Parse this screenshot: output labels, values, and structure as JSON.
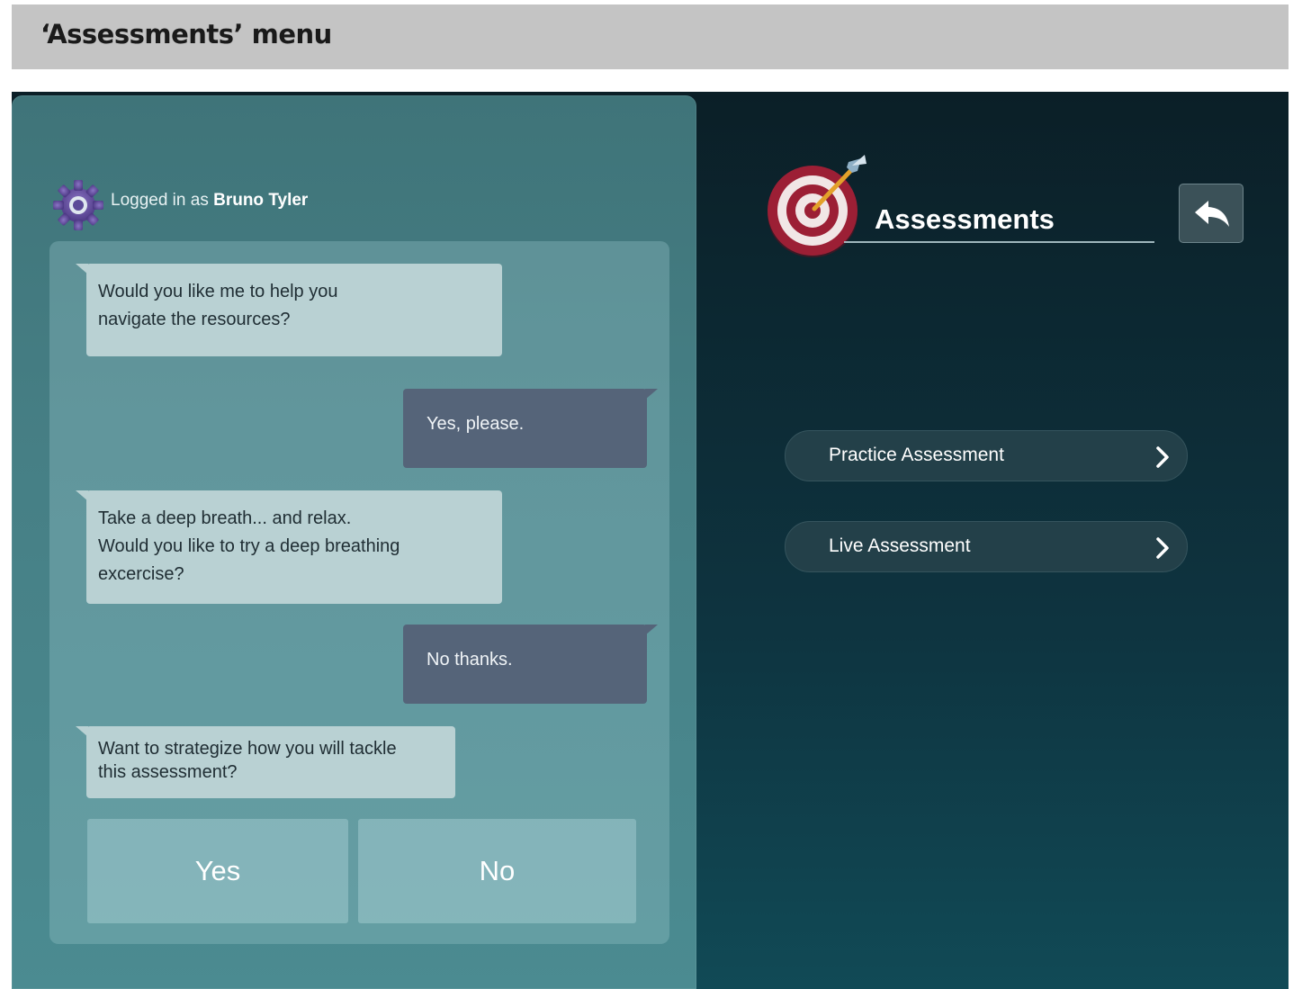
{
  "page_title": "‘Assessments’ menu",
  "chat": {
    "login_prefix": "Logged in as",
    "user_name": "Bruno Tyler",
    "messages": [
      {
        "role": "bot",
        "lines": [
          "Would you like me to help you",
          "navigate the resources?"
        ]
      },
      {
        "role": "user",
        "lines": [
          "Yes, please."
        ]
      },
      {
        "role": "bot",
        "lines": [
          "Take a deep breath... and relax.",
          "Would you like to try a deep breathing",
          "excercise?"
        ]
      },
      {
        "role": "user",
        "lines": [
          "No thanks."
        ]
      },
      {
        "role": "bot",
        "lines": [
          "Want to strategize how you will tackle",
          "this assessment?"
        ]
      }
    ],
    "choices": {
      "yes": "Yes",
      "no": "No"
    }
  },
  "assessments": {
    "title": "Assessments",
    "back_icon": "back-arrow-icon",
    "items": [
      {
        "label": "Practice Assessment",
        "icon": "chevron-right-icon"
      },
      {
        "label": "Live Assessment",
        "icon": "chevron-right-icon"
      }
    ]
  },
  "colors": {
    "chat_panel": "#467f85",
    "bot_bubble": "#b9d1d3",
    "user_bubble": "#556479",
    "app_background": "#0e3440",
    "menu_item": "#234049"
  }
}
